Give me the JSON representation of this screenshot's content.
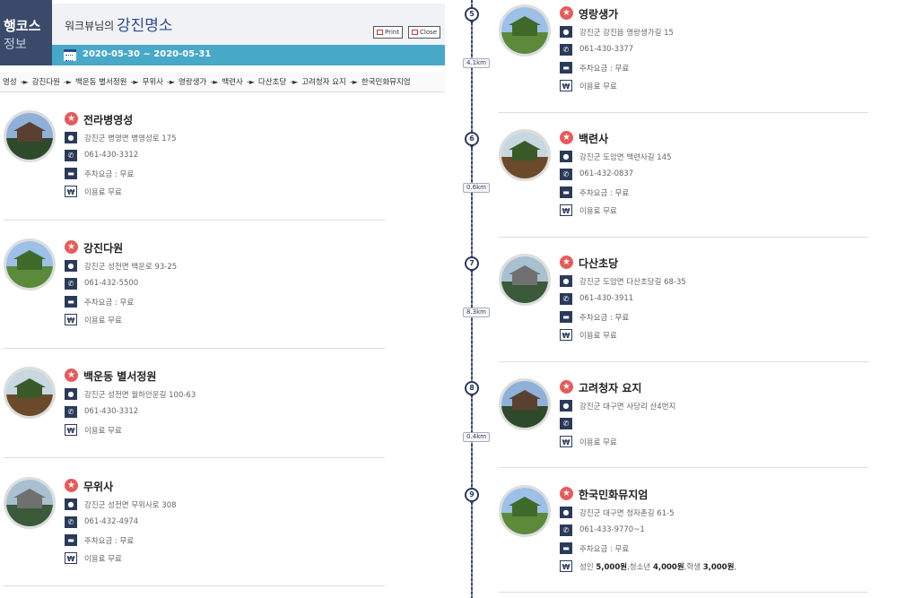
{
  "header": {
    "tab_line1": "행코스",
    "tab_line2": "정보",
    "owner": "워크뷰님의",
    "course_name": "강진명소",
    "print_label": "Print",
    "close_label": "Close",
    "date_range": "2020-05-30 ~ 2020-05-31"
  },
  "route": [
    "영성",
    "강진다원",
    "백운동 별서정원",
    "무위사",
    "영랑생가",
    "백련사",
    "다산초당",
    "고려청자 요지",
    "한국민화뮤지엄"
  ],
  "left_places": [
    {
      "title": "전라병영성",
      "address": "강진군 병영면 병영성로 175",
      "phone": "061-430-3312",
      "parking": "주차요금 : 무료",
      "fee": "이용료 무료"
    },
    {
      "title": "강진다원",
      "address": "강진군 성전면 백운로 93-25",
      "phone": "061-432-5500",
      "parking": "주차요금 : 무료",
      "fee": "이용료 무료"
    },
    {
      "title": "백운동 별서정원",
      "address": "강진군 성전면 월하안운길 100-63",
      "phone": "061-430-3312",
      "fee": "이용료 무료"
    },
    {
      "title": "무위사",
      "address": "강진군 성전면 무위사로 308",
      "phone": "061-432-4974",
      "parking": "주차요금 : 무료",
      "fee": "이용료 무료"
    }
  ],
  "right_places": [
    {
      "number": "5",
      "title": "영랑생가",
      "address": "강진군 강진읍 영랑생가길 15",
      "phone": "061-430-3377",
      "parking": "주차요금 : 무료",
      "fee": "이용료 무료",
      "distance_after": "4.1km"
    },
    {
      "number": "6",
      "title": "백련사",
      "address": "강진군 도암면 백련사길 145",
      "phone": "061-432-0837",
      "parking": "주차요금 : 무료",
      "fee": "이용료 무료",
      "distance_after": "0.6km"
    },
    {
      "number": "7",
      "title": "다산초당",
      "address": "강진군 도암면 다산초당길 68-35",
      "phone": "061-430-3911",
      "parking": "주차요금 : 무료",
      "fee": "이용료 무료",
      "distance_after": "8.3km"
    },
    {
      "number": "8",
      "title": "고려청자 요지",
      "address": "강진군 대구면 사당리 산4번지",
      "phone": "",
      "fee": "이용료 무료",
      "distance_after": "0.4km"
    },
    {
      "number": "9",
      "title": "한국민화뮤지엄",
      "address": "강진군 대구면 청자촌길 61-5",
      "phone": "061-433-9770~1",
      "parking": "주차요금 : 무료",
      "fee_parts": {
        "adult_label": "성인 ",
        "adult_price": "5,000원",
        "youth_label": ",청소년 ",
        "youth_price": "4,000원",
        "student_label": ",학생 ",
        "student_price": "3,000원",
        "tail": ","
      }
    }
  ],
  "icons": {
    "star": "star-icon",
    "location": "location-pin-icon",
    "phone": "phone-icon",
    "parking": "car-icon",
    "fee": "won-icon",
    "calendar": "calendar-icon"
  },
  "colors": {
    "nav": "#3a4a6b",
    "datebar": "#48a8c8",
    "star": "#e85a5a",
    "title_accent": "#2a4a8a"
  }
}
